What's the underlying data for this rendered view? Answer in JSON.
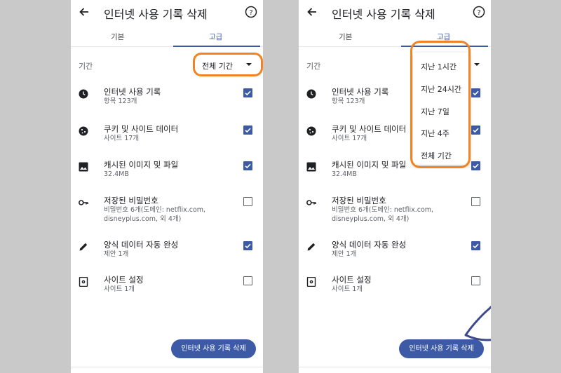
{
  "screen": {
    "title": "인터넷 사용 기록 삭제",
    "tabs": [
      "기본",
      "고급"
    ],
    "period_label": "기간",
    "period_value": "전체 기간",
    "items": [
      {
        "title": "인터넷 사용 기록",
        "sub": "항목 123개",
        "checked": true,
        "icon": "clock-icon"
      },
      {
        "title": "쿠키 및 사이트 데이터",
        "sub": "사이트 17개",
        "checked": true,
        "icon": "cookie-icon"
      },
      {
        "title": "캐시된 이미지 및 파일",
        "sub": "32.4MB",
        "checked": true,
        "icon": "image-icon"
      },
      {
        "title": "저장된 비밀번호",
        "sub": "비밀번호 6개(도메인: netflix.com, disneyplus.com, 외 4개)",
        "checked": false,
        "icon": "key-icon"
      },
      {
        "title": "양식 데이터 자동 완성",
        "sub": "제안 1개",
        "checked": true,
        "icon": "pencil-icon"
      },
      {
        "title": "사이트 설정",
        "sub": "사이트 1개",
        "checked": false,
        "icon": "site-settings-icon"
      }
    ],
    "delete_button": "인터넷 사용 기록 삭제"
  },
  "dropdown": {
    "options": [
      "지난 1시간",
      "지난 24시간",
      "지난 7일",
      "지난 4주",
      "전체 기간"
    ]
  },
  "colors": {
    "accent": "#3c5aa6",
    "highlight": "#f58220",
    "background": "#c9c9c9"
  }
}
